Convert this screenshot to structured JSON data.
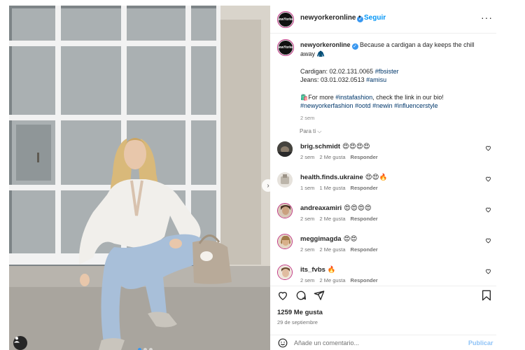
{
  "post": {
    "username": "newyorkeronline",
    "follow_label": "Seguir",
    "dot_separator": "•",
    "more_label": "···",
    "avatar_text": "NewYorker"
  },
  "caption": {
    "username": "newyorkeronline",
    "line1": "Because a cardigan a day keeps the chill away 🧥",
    "cardigan_prefix": "Cardigan: 02.02.131.0065 ",
    "cardigan_tag": "#fbsister",
    "jeans_prefix": "Jeans: 03.01.032.0513 ",
    "jeans_tag": "#amisu",
    "more_prefix": "🛍️For more ",
    "more_tag": "#instafashion",
    "more_suffix": ", check the link in our bio!",
    "hashtags": "#newyorkerfashion #ootd #newin #influencerstyle",
    "time": "2 sem"
  },
  "para_ti": "Para ti ⌵",
  "comments": [
    {
      "username": "brig.schmidt",
      "text": "😍😍😍😍",
      "time": "2 sem",
      "likes": "2 Me gusta",
      "reply": "Responder"
    },
    {
      "username": "health.finds.ukraine",
      "text": "😍😍🔥",
      "time": "1 sem",
      "likes": "1 Me gusta",
      "reply": "Responder"
    },
    {
      "username": "andreaxamiri",
      "text": "😍😍😍😍",
      "time": "2 sem",
      "likes": "2 Me gusta",
      "reply": "Responder"
    },
    {
      "username": "meggimagda",
      "text": "😍😍",
      "time": "2 sem",
      "likes": "2 Me gusta",
      "reply": "Responder"
    },
    {
      "username": "its_fvbs",
      "text": "🔥",
      "time": "2 sem",
      "likes": "2 Me gusta",
      "reply": "Responder"
    }
  ],
  "actions": {
    "likes": "1259 Me gusta",
    "date": "29 de septiembre"
  },
  "composer": {
    "placeholder": "Añade un comentario...",
    "publish_label": "Publicar"
  },
  "photo": {
    "carousel_index": 1,
    "carousel_count": 3
  },
  "colors": {
    "accent": "#0095f6",
    "publish_disabled": "#8fc3f7",
    "story_ring": "#c13584",
    "link": "#00376b"
  },
  "icons": [
    "verified-icon",
    "more-icon",
    "chevron-right-icon",
    "user-tag-icon",
    "heart-icon",
    "comment-icon",
    "share-icon",
    "save-icon",
    "emoji-icon"
  ]
}
